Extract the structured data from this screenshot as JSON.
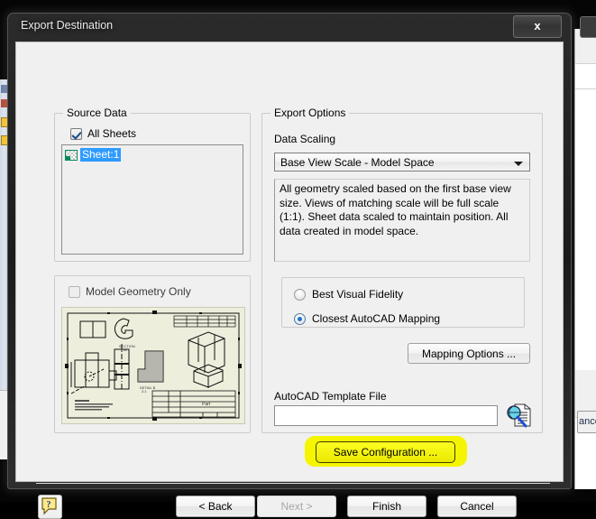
{
  "window": {
    "title": "Export Destination",
    "close_label": "x"
  },
  "source_data": {
    "legend": "Source Data",
    "all_sheets_label": "All Sheets",
    "all_sheets_checked": true,
    "sheets": [
      {
        "label": "Sheet:1",
        "selected": true
      }
    ]
  },
  "model_geometry": {
    "legend": "",
    "checkbox_label": "Model Geometry Only",
    "checked": false,
    "preview_alt": "drawing-sheet-preview"
  },
  "export_options": {
    "legend": "Export Options",
    "data_scaling_label": "Data Scaling",
    "data_scaling_value": "Base View Scale - Model Space",
    "description": "All geometry scaled based on the first base view size. Views of matching scale will be full scale (1:1). Sheet data scaled to maintain position. All data created in model space.",
    "radios": [
      {
        "label": "Best Visual Fidelity",
        "selected": false
      },
      {
        "label": "Closest AutoCAD Mapping",
        "selected": true
      }
    ],
    "mapping_options_label": "Mapping Options ...",
    "template_file_label": "AutoCAD Template File",
    "template_file_value": "",
    "template_file_placeholder": "",
    "browse_icon": "magnifier-document-icon"
  },
  "actions": {
    "save_configuration_label": "Save Configuration ...",
    "save_configuration_highlighted": true,
    "back_label": "< Back",
    "next_label": "Next >",
    "next_enabled": false,
    "finish_label": "Finish",
    "cancel_label": "Cancel",
    "help_icon": "help-question-icon"
  },
  "background": {
    "right_window_button_label": "ance"
  },
  "colors": {
    "highlight_yellow": "#f5f500",
    "button_yellow": "#fdfd22",
    "selection_blue": "#2f9bff",
    "radio_blue": "#1a73c8",
    "dialog_face": "#f0f0f0",
    "preview_paper": "#eeeedd"
  }
}
